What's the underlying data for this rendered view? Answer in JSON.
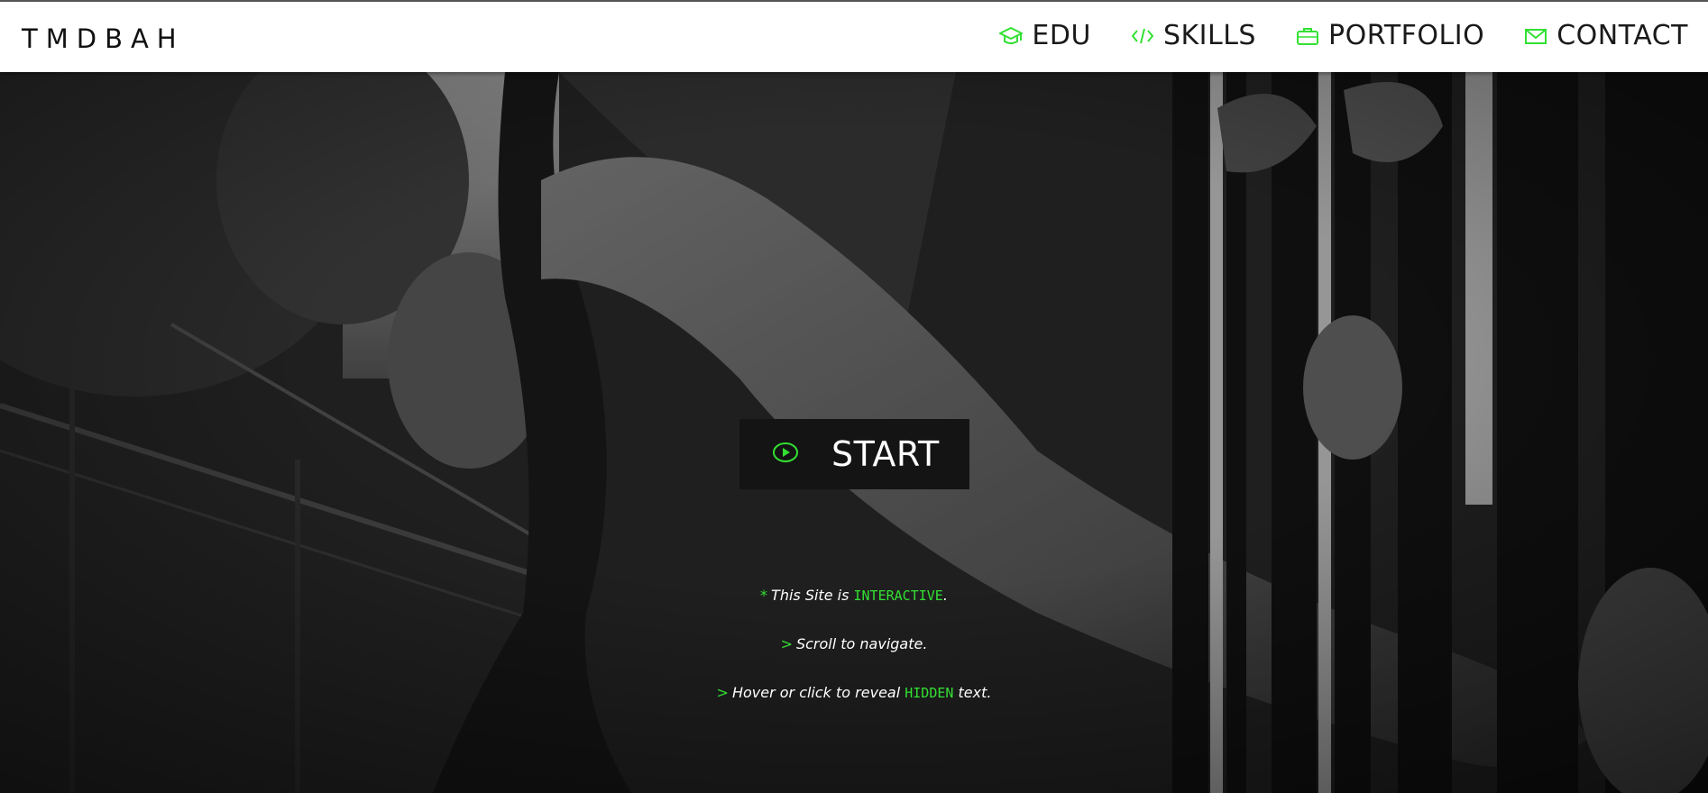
{
  "brand": "TMDBAH",
  "accent_color": "#33e033",
  "nav": [
    {
      "label": "EDU",
      "icon": "graduation-cap-icon"
    },
    {
      "label": "SKILLS",
      "icon": "code-icon"
    },
    {
      "label": "PORTFOLIO",
      "icon": "briefcase-icon"
    },
    {
      "label": "CONTACT",
      "icon": "envelope-icon"
    }
  ],
  "hero": {
    "start_label": "START",
    "start_icon": "play-circle-icon",
    "notes": [
      {
        "mark": "*",
        "before": "This Site is ",
        "code": "INTERACTIVE",
        "after": "."
      },
      {
        "mark": ">",
        "before": "Scroll to navigate.",
        "code": "",
        "after": ""
      },
      {
        "mark": ">",
        "before": "Hover or click to reveal ",
        "code": "HIDDEN",
        "after": " text."
      }
    ]
  }
}
